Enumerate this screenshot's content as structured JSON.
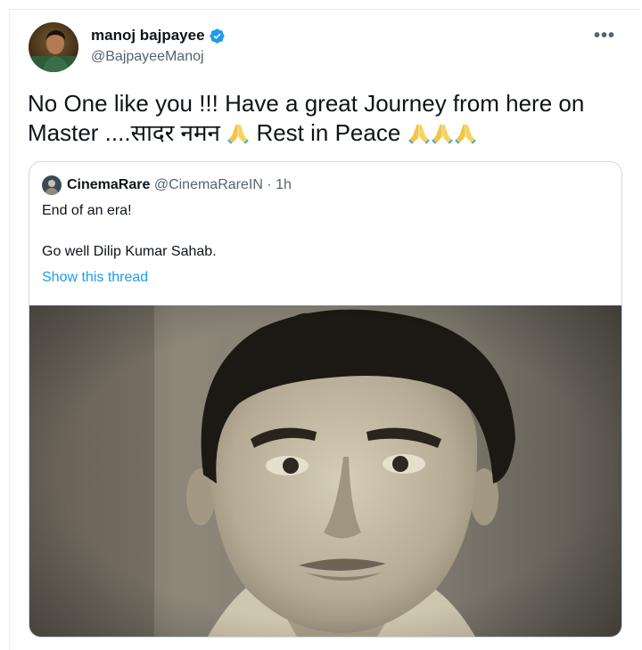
{
  "tweet": {
    "author": {
      "name": "manoj bajpayee",
      "handle": "@BajpayeeManoj",
      "verified": true
    },
    "more_menu": "•••",
    "text": {
      "line1": "No One like you !!! Have a great Journey from here on",
      "line2_start": "Master ....सादर नमन",
      "line2_mid": "Rest in Peace",
      "emoji_icon": "folded-hands-icon"
    },
    "quoted": {
      "name": "CinemaRare",
      "handle": "@CinemaRareIN",
      "separator": "·",
      "time": "1h",
      "line1": "End of an era!",
      "line2": "Go well Dilip Kumar Sahab.",
      "show_thread": "Show this thread"
    }
  },
  "colors": {
    "text_primary": "#0f1419",
    "text_secondary": "#536471",
    "link": "#1d9bf0",
    "verified_badge": "#1d9bf0",
    "border": "#cfd9de"
  }
}
